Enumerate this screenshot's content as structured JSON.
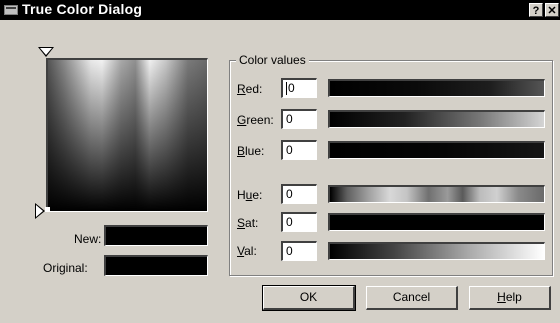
{
  "window": {
    "title": "True Color Dialog",
    "help_glyph": "?",
    "close_glyph": "✕"
  },
  "swatches": {
    "new_label": "New:",
    "original_label": "Original:",
    "new_color": "#000000",
    "original_color": "#000000"
  },
  "color_values": {
    "group_title": "Color values",
    "rows": [
      {
        "key": "red",
        "label_hotkey": "R",
        "label_rest": "ed:",
        "value": "0"
      },
      {
        "key": "green",
        "label_hotkey": "G",
        "label_rest": "reen:",
        "value": "0"
      },
      {
        "key": "blue",
        "label_hotkey": "B",
        "label_rest": "lue:",
        "value": "0"
      },
      {
        "key": "hue",
        "label_pre": "H",
        "label_hotkey": "u",
        "label_rest": "e:",
        "value": "0"
      },
      {
        "key": "sat",
        "label_hotkey": "S",
        "label_rest": "at:",
        "value": "0"
      },
      {
        "key": "val",
        "label_hotkey": "V",
        "label_rest": "al:",
        "value": "0"
      }
    ]
  },
  "buttons": {
    "ok": "OK",
    "cancel": "Cancel",
    "help_hotkey": "H",
    "help_rest": "elp"
  }
}
